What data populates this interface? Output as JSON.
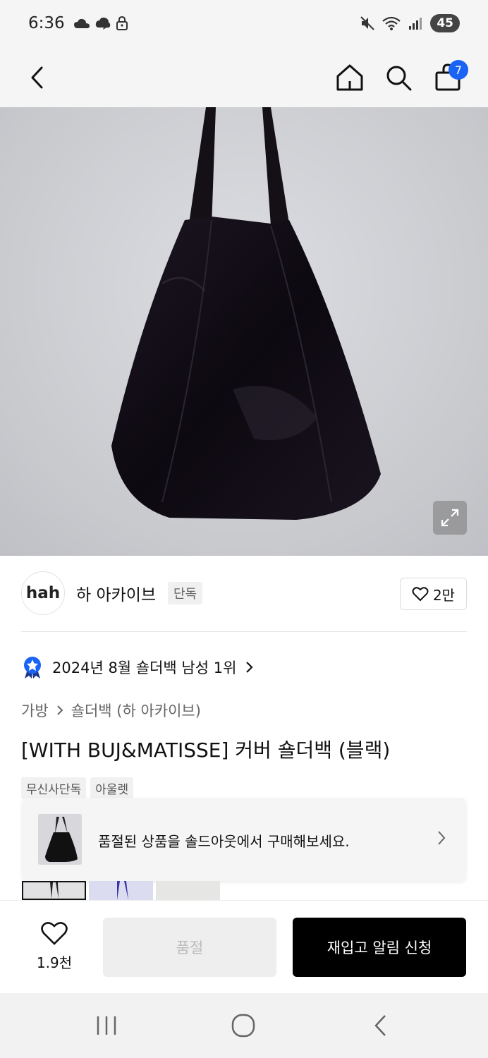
{
  "status_bar": {
    "time": "6:36",
    "battery": "45",
    "left_icons": [
      "cloud-icon",
      "cloud-icon",
      "lock-icon"
    ],
    "right_icons": [
      "mute-icon",
      "wifi-icon",
      "signal-icon"
    ]
  },
  "top_nav": {
    "icons": [
      "back-icon",
      "home-icon",
      "search-icon",
      "bag-icon"
    ],
    "cart_count": "7"
  },
  "brand": {
    "logo": "hah",
    "name": "하 아카이브",
    "tag": "단독",
    "like_count": "2만"
  },
  "ranking": {
    "text": "2024년 8월 숄더백 남성 1위"
  },
  "breadcrumb": {
    "items": [
      "가방",
      "숄더백 (하 아카이브)"
    ]
  },
  "product": {
    "title": "[WITH BUJ&MATISSE] 커버 숄더백 (블랙)",
    "tags": [
      "무신사단독",
      "아울렛"
    ]
  },
  "soldout_card": {
    "text": "품절된 상품을 솔드아웃에서 구매해보세요."
  },
  "bottom_bar": {
    "wish_count": "1.9천",
    "soldout_label": "품절",
    "restock_label": "재입고 알림 신청"
  },
  "colors": {
    "accent": "#1a63f5",
    "primary_button": "#000000",
    "disabled_button": "#eeeeee"
  },
  "system_nav": {
    "icons": [
      "recent-apps-icon",
      "home-circle-icon",
      "back-icon"
    ]
  }
}
